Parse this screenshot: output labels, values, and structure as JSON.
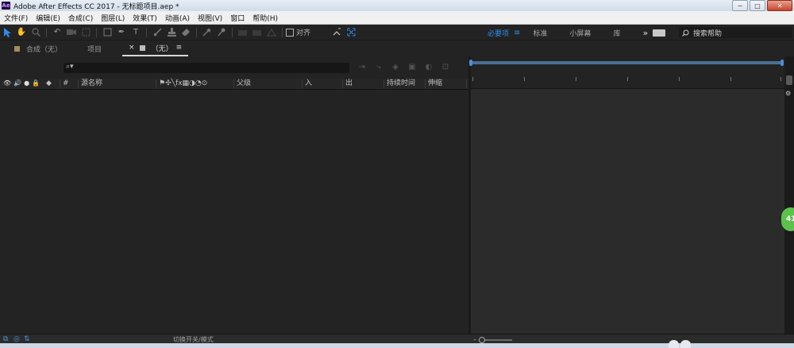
{
  "window": {
    "logo": "Ae",
    "title": "Adobe After Effects CC 2017 - 无标题项目.aep *",
    "controls": [
      "─",
      "□",
      "✕"
    ]
  },
  "menu": [
    "文件(F)",
    "编辑(E)",
    "合成(C)",
    "图层(L)",
    "效果(T)",
    "动画(A)",
    "视图(V)",
    "窗口",
    "帮助(H)"
  ],
  "toolbar": {
    "align_label": "对齐",
    "workspaces": [
      "必要项",
      "标准",
      "小屏幕",
      "库"
    ],
    "active_workspace": "必要项",
    "more": "»",
    "search_placeholder": "搜索帮助"
  },
  "tabs": [
    {
      "label": "合成（无）",
      "swatch": "#a38b5a"
    },
    {
      "label": "项目"
    },
    {
      "close": "×",
      "label": "（无）",
      "menu": "≡",
      "swatch": "#bdbdbd"
    }
  ],
  "timeline": {
    "search_icon": "⌕▾",
    "columns": {
      "layer_name": "源名称",
      "parent": "父级",
      "in": "入",
      "out": "出",
      "duration": "持续时间",
      "stretch": "伸缩",
      "hash": "#"
    }
  },
  "bottom": {
    "toggle_label": "切换开关/模式"
  },
  "badge": "41",
  "colors": {
    "accent": "#2d8ceb",
    "panel_bg": "#232323",
    "navigator": "#4b6f94",
    "badge": "#5cc24b"
  }
}
